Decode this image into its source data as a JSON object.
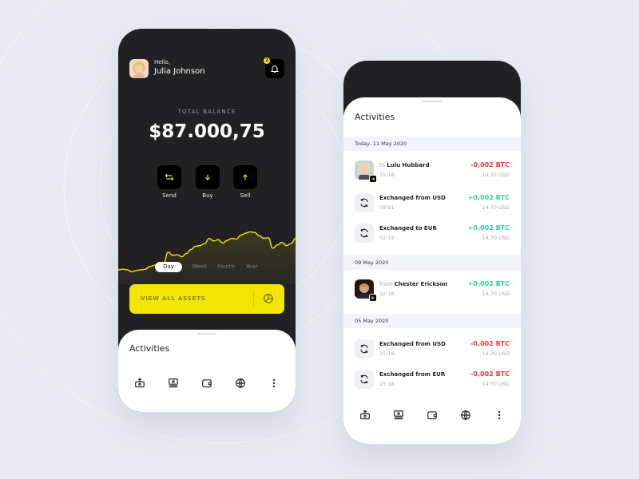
{
  "colors": {
    "accent": "#f2e600",
    "dark": "#212124",
    "negative": "#e63b3b",
    "positive": "#2fd39a",
    "background": "#e8ebf3"
  },
  "home": {
    "greeting": "Hello,",
    "user_name": "Julia Johnson",
    "notification_count": "2",
    "balance_label": "TOTAL BALANCE",
    "balance_value": "$87.000,75",
    "actions": [
      {
        "label": "Send",
        "icon": "swap-arrows-icon"
      },
      {
        "label": "Buy",
        "icon": "arrow-down-icon"
      },
      {
        "label": "Sell",
        "icon": "arrow-up-icon"
      }
    ],
    "periods": [
      {
        "label": "Day",
        "active": true
      },
      {
        "label": "Week",
        "active": false
      },
      {
        "label": "Month",
        "active": false
      },
      {
        "label": "Year",
        "active": false
      }
    ],
    "assets_button": "VIEW ALL ASSETS",
    "sheet_title": "Activities"
  },
  "chart_data": {
    "type": "area",
    "title": "",
    "xlabel": "",
    "ylabel": "",
    "period": "Day",
    "values": [
      22,
      23,
      22,
      19,
      21,
      22,
      23,
      27,
      29,
      31,
      33,
      49,
      44,
      45,
      42,
      47,
      53,
      58,
      59,
      62,
      70,
      66,
      68,
      63,
      67,
      70,
      69,
      75,
      78,
      80,
      79,
      74,
      70,
      71,
      55,
      60,
      64,
      59,
      62,
      70
    ]
  },
  "activities": {
    "title": "Activities",
    "groups": [
      {
        "date": "Today, 11 May 2020",
        "items": [
          {
            "type": "person",
            "prefix": "to",
            "name": "Lulu Hubbard",
            "time": "15:18",
            "amount": "-0,002 BTC",
            "usd": "14,70 USD",
            "sign": "neg",
            "direction": "outgoing"
          },
          {
            "type": "exchange",
            "prefix": "",
            "name": "Exchanged from USD",
            "time": "09:01",
            "amount": "+0,002 BTC",
            "usd": "14,70 USD",
            "sign": "pos"
          },
          {
            "type": "exchange",
            "prefix": "",
            "name": "Exchanged to EUR",
            "time": "02:15",
            "amount": "+0,002 BTC",
            "usd": "14,70 USD",
            "sign": "pos"
          }
        ]
      },
      {
        "date": "09 May 2020",
        "items": [
          {
            "type": "person",
            "prefix": "from",
            "name": "Chester Erickson",
            "time": "22:18",
            "amount": "+0,002 BTC",
            "usd": "14,70 USD",
            "sign": "pos",
            "direction": "incoming"
          }
        ]
      },
      {
        "date": "05 May 2020",
        "items": [
          {
            "type": "exchange",
            "prefix": "",
            "name": "Exchanged from USD",
            "time": "15:18",
            "amount": "-0,002 BTC",
            "usd": "14,70 USD",
            "sign": "neg"
          },
          {
            "type": "exchange",
            "prefix": "",
            "name": "Exchanged from EUR",
            "time": "15:18",
            "amount": "-0,002 BTC",
            "usd": "14,70 USD",
            "sign": "neg"
          }
        ]
      }
    ]
  },
  "nav": [
    {
      "name": "deposit",
      "icon": "deposit-icon"
    },
    {
      "name": "money",
      "icon": "money-icon"
    },
    {
      "name": "wallet",
      "icon": "wallet-icon"
    },
    {
      "name": "globe",
      "icon": "globe-icon"
    },
    {
      "name": "more",
      "icon": "more-vertical-icon"
    }
  ]
}
